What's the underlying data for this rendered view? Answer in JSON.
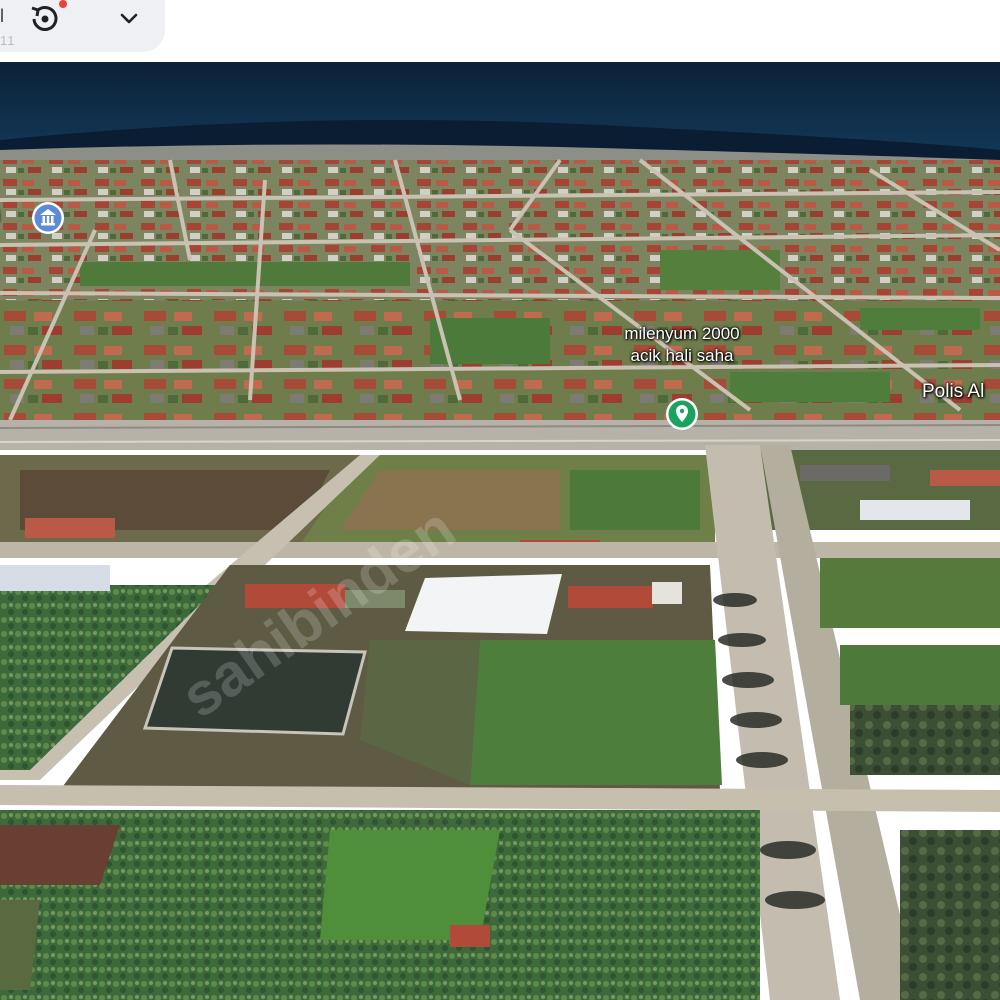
{
  "toolbar": {
    "counter_text": "11",
    "partial_char": "l",
    "history_icon": "history-icon",
    "dropdown_icon": "chevron-down-icon"
  },
  "map": {
    "venue_label_line1": "milenyum 2000",
    "venue_label_line2": "acik hali saha",
    "polis_label": "Polis Al",
    "left_label": "i",
    "venue_pin_icon": "location-pin-icon",
    "left_pin_icon": "landmark-icon",
    "watermark": "sahibinden"
  },
  "colors": {
    "sea": "#0f2a44",
    "accent_pin": "#1aa260",
    "landmark_pin": "#5b8bd9"
  }
}
